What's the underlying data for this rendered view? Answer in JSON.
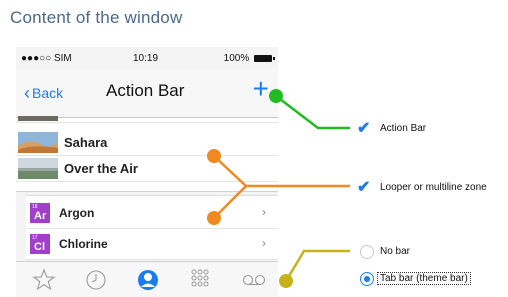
{
  "heading": "Content of the window",
  "phone": {
    "status": {
      "carrier": "●●●○○ SIM",
      "time": "10:19",
      "battery": "100%"
    },
    "navbar": {
      "back_label": "Back",
      "title": "Action Bar",
      "add_glyph": "+"
    },
    "list": [
      {
        "label": "Sahara",
        "thumb": "desert"
      },
      {
        "label": "Over the Air",
        "thumb": "field"
      }
    ],
    "elements": [
      {
        "number": "18",
        "symbol": "Ar",
        "name": "Argon"
      },
      {
        "number": "17",
        "symbol": "Cl",
        "name": "Chlorine"
      }
    ],
    "tabs": [
      "star-icon",
      "clock-icon",
      "contacts-icon",
      "keypad-icon",
      "voicemail-icon"
    ],
    "active_tab_index": 2
  },
  "options": {
    "action_bar": {
      "label": "Action Bar",
      "checked": true
    },
    "looper": {
      "label": "Looper or multiline zone",
      "checked": true
    },
    "no_bar": {
      "label": "No bar",
      "selected": false
    },
    "tab_bar": {
      "label": "Tab bar (theme bar)",
      "selected": true
    }
  },
  "colors": {
    "accent": "#1a7cf0",
    "green": "#22bb22",
    "orange": "#f08a20",
    "yellow": "#c8b21a",
    "element_purple": "#a040c8"
  }
}
